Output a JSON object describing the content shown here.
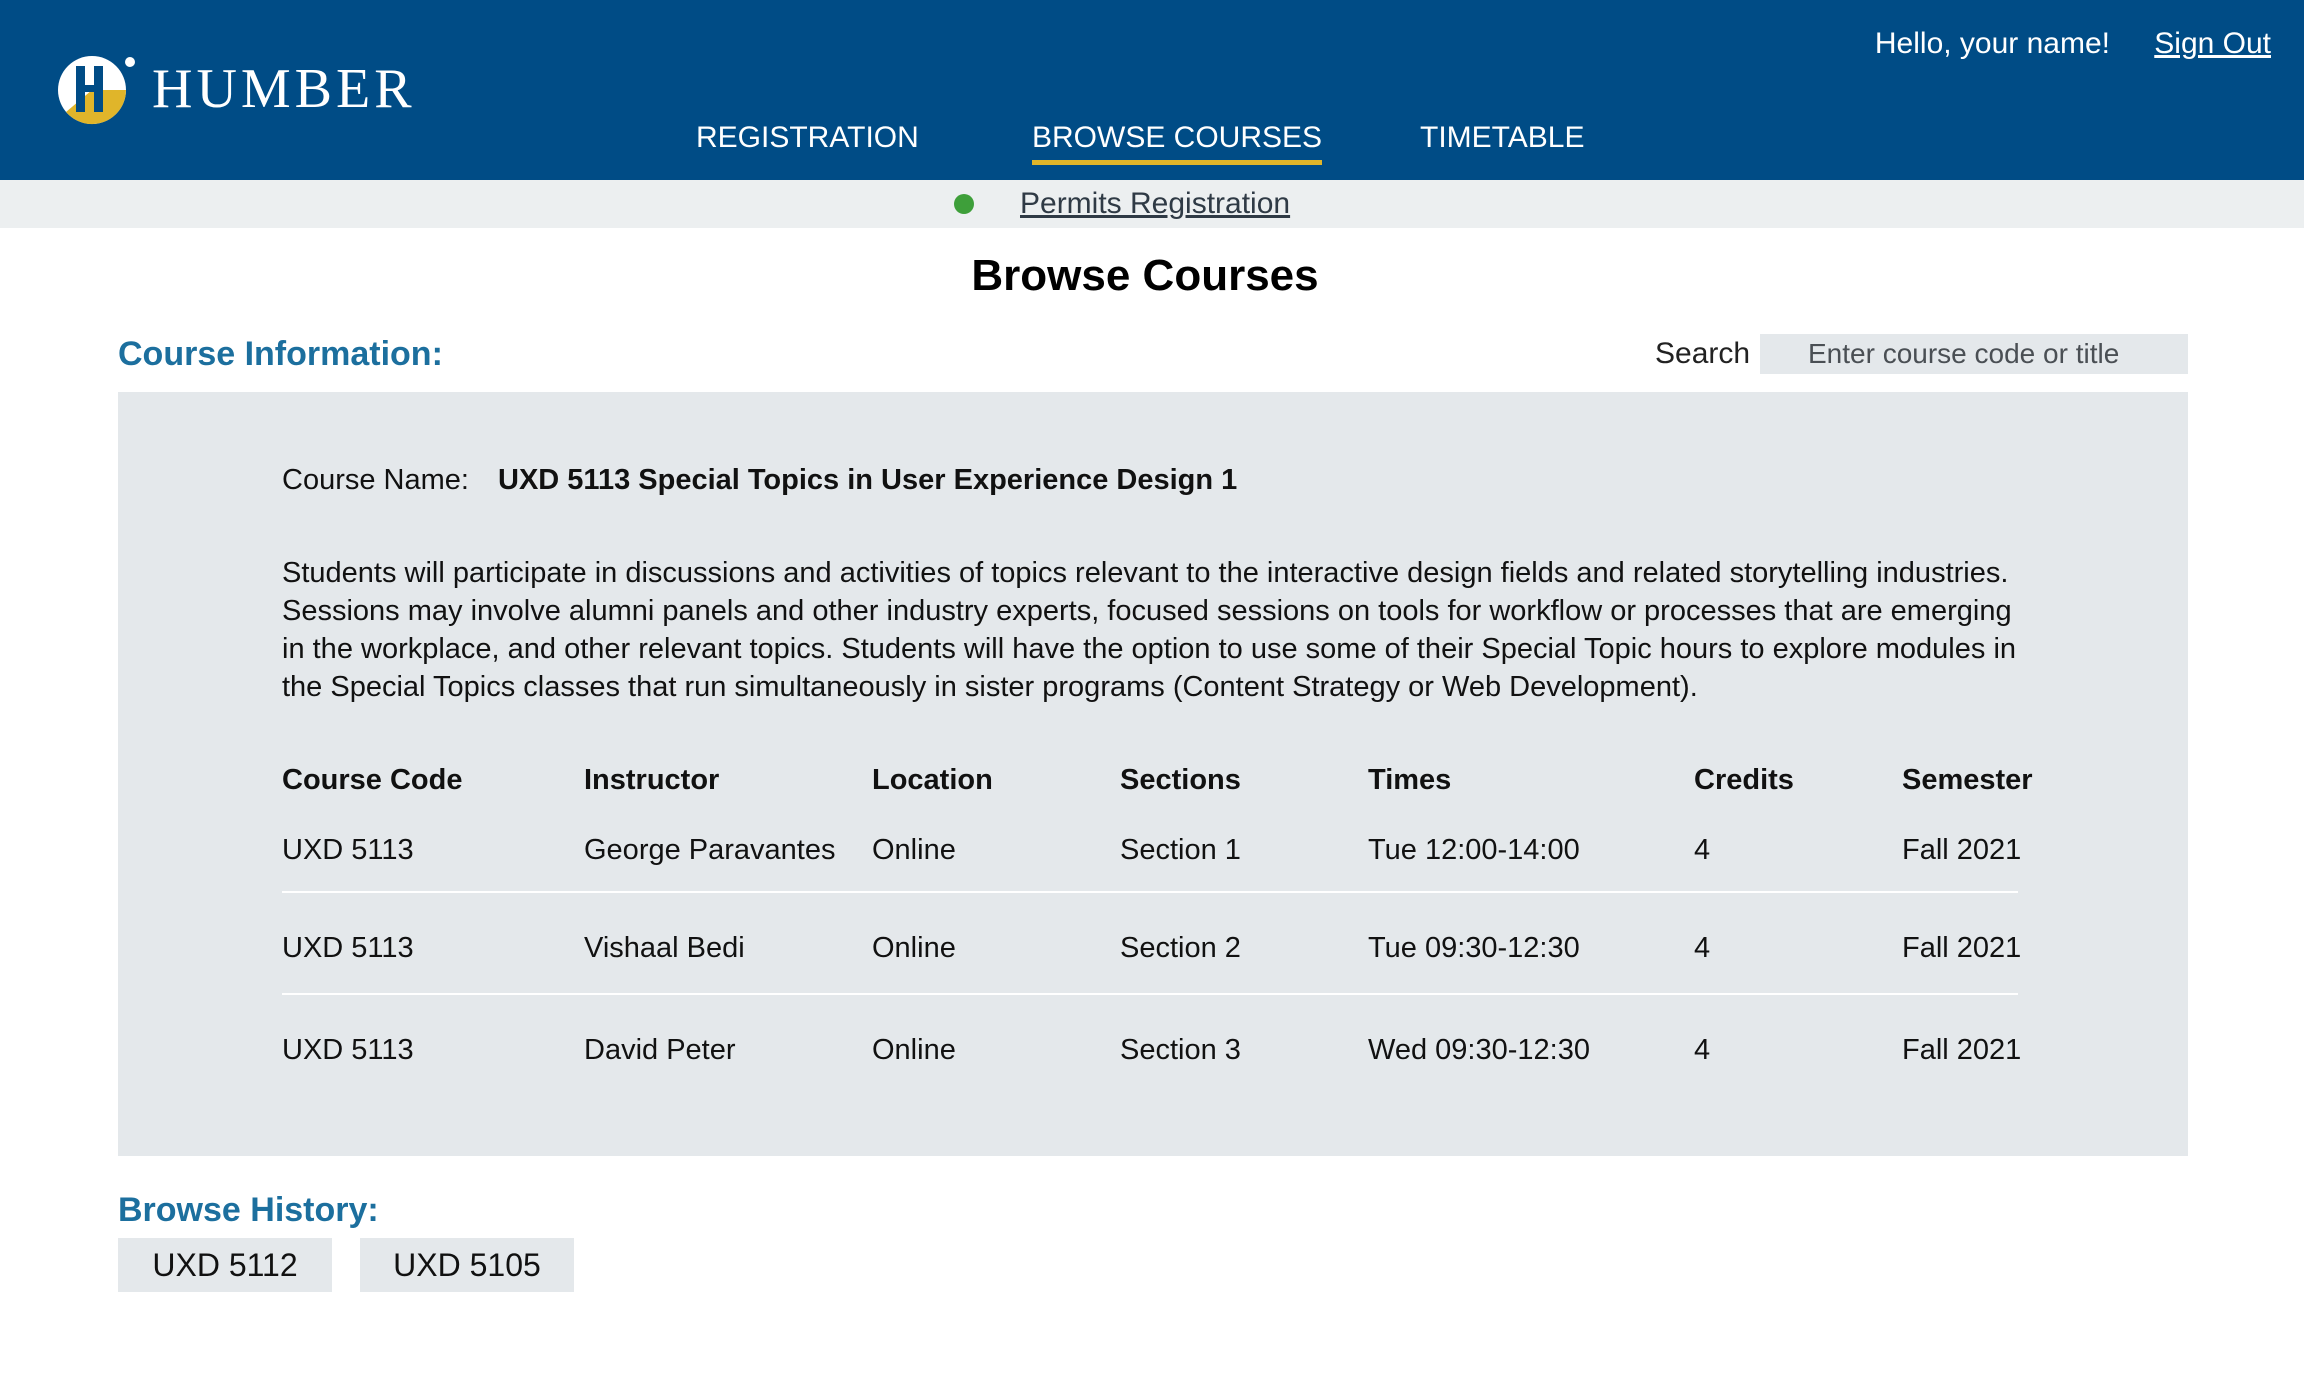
{
  "header": {
    "logo_text": "HUMBER",
    "greeting": "Hello, your name!",
    "sign_out": "Sign Out",
    "nav": [
      {
        "label": "REGISTRATION",
        "active": false
      },
      {
        "label": "BROWSE COURSES",
        "active": true
      },
      {
        "label": "TIMETABLE",
        "active": false
      }
    ],
    "brand_color": "#004c86",
    "accent_color": "#e0b52a"
  },
  "subbar": {
    "permits_label": "Permits Registration",
    "status_color": "#3e9f3a"
  },
  "page": {
    "title": "Browse Courses"
  },
  "course_info": {
    "section_label": "Course Information:",
    "search_label": "Search",
    "search_placeholder": "Enter course code or title",
    "course_name_label": "Course Name:",
    "course_name": "UXD 5113  Special Topics in User Experience Design 1",
    "description": "Students will participate in discussions and activities of topics relevant to the interactive design fields and related storytelling industries. Sessions may involve alumni panels and other industry experts, focused sessions on tools for workflow or processes that are emerging in the workplace, and other relevant topics. Students will have the option to use some of their Special Topic hours to explore modules in the Special Topics classes that run simultaneously in sister programs (Content Strategy or Web Development).",
    "columns": [
      "Course Code",
      "Instructor",
      "Location",
      "Sections",
      "Times",
      "Credits",
      "Semester"
    ],
    "rows": [
      [
        "UXD 5113",
        "George Paravantes",
        "Online",
        "Section 1",
        "Tue 12:00-14:00",
        "4",
        "Fall 2021"
      ],
      [
        "UXD 5113",
        "Vishaal Bedi",
        "Online",
        "Section 2",
        "Tue 09:30-12:30",
        "4",
        "Fall 2021"
      ],
      [
        "UXD 5113",
        "David Peter",
        "Online",
        "Section 3",
        "Wed 09:30-12:30",
        "4",
        "Fall 2021"
      ]
    ]
  },
  "history": {
    "label": "Browse History:",
    "items": [
      "UXD 5112",
      "UXD 5105"
    ]
  }
}
